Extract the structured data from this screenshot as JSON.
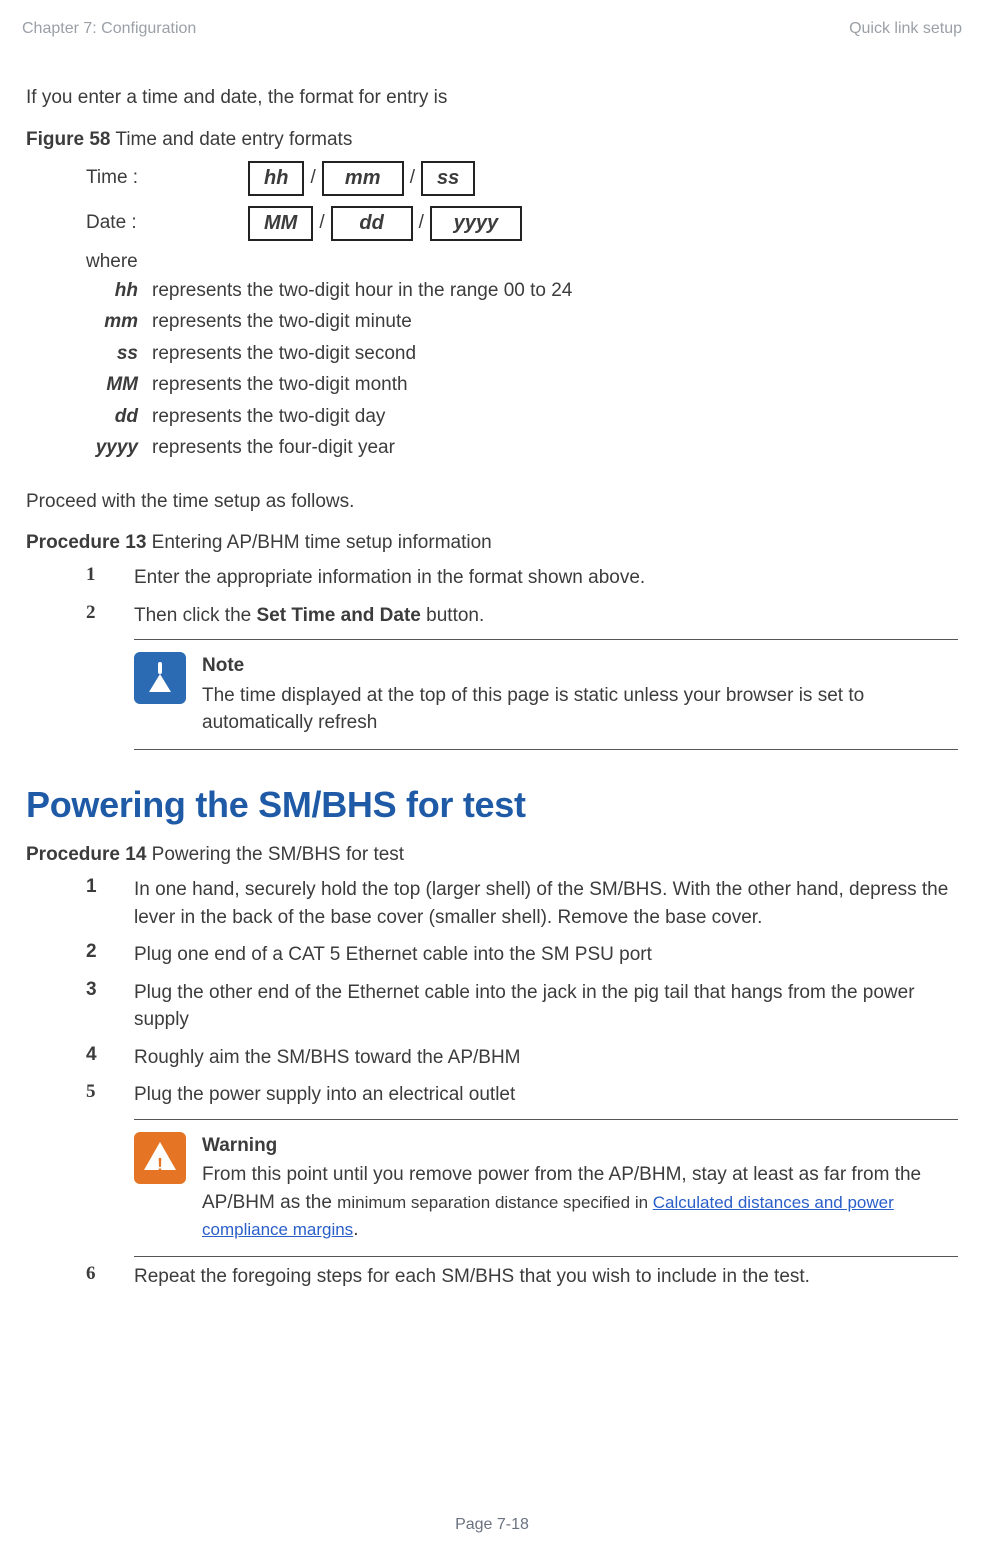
{
  "runhead": {
    "left": "Chapter 7:  Configuration",
    "right": "Quick link setup"
  },
  "intro_para": "If you enter a time and date, the format for entry is",
  "figure": {
    "lead": "Figure 58",
    "caption": "  Time and date entry formats",
    "time_label": "Time :",
    "date_label": "Date :",
    "time_cells": {
      "a": "hh",
      "b": "mm",
      "c": "ss"
    },
    "date_cells": {
      "a": "MM",
      "b": "dd",
      "c": "yyyy"
    },
    "sep": "/",
    "where": "where",
    "defs": {
      "hh_sym": "hh",
      "hh_txt": "represents the two-digit hour in the range 00 to 24",
      "mm_sym": "mm",
      "mm_txt": "represents the two-digit minute",
      "ss_sym": "ss",
      "ss_txt": "represents the two-digit second",
      "MM_sym": "MM",
      "MM_txt": "represents the two-digit month",
      "dd_sym": "dd",
      "dd_txt": "represents the two-digit day",
      "yyyy_sym": "yyyy",
      "yyyy_txt": "represents the four-digit year"
    }
  },
  "proceed_para": "Proceed with the time setup as follows.",
  "proc13": {
    "lead": "Procedure 13",
    "caption": "  Entering AP/BHM time setup information",
    "step1_num": "1",
    "step1_txt": "Enter the appropriate information in the format shown above.",
    "step2_num": "2",
    "step2_pre": "Then click the ",
    "step2_bold": "Set Time and Date",
    "step2_post": " button.",
    "note_title": "Note",
    "note_body": "The time displayed at the top of this page is static unless your browser is set to automatically refresh"
  },
  "h2": "Powering the SM/BHS for test",
  "proc14": {
    "lead": "Procedure 14",
    "caption": "  Powering the SM/BHS for test",
    "step1_num": "1",
    "step1_txt": "In one hand, securely hold the top (larger shell) of the SM/BHS. With the other hand, depress the lever in the back of the base cover (smaller shell). Remove the base cover.",
    "step2_num": "2",
    "step2_txt": "Plug one end of a CAT 5 Ethernet cable into the SM PSU port",
    "step3_num": "3",
    "step3_txt": "Plug the other end of the Ethernet cable into the jack in the pig tail that hangs from the power supply",
    "step4_num": "4",
    "step4_txt": "Roughly aim the SM/BHS toward the AP/BHM",
    "step5_num": "5",
    "step5_txt": "Plug the power supply into an electrical outlet",
    "warn_title": "Warning",
    "warn_pre": "From this point until you remove power from the AP/BHM, stay at least as far from the AP/BHM as the ",
    "warn_small": "minimum separation distance specified in ",
    "warn_link": "Calculated distances and power compliance margins",
    "warn_post": ".",
    "step6_num": "6",
    "step6_txt": "Repeat the foregoing steps for each SM/BHS that you wish to include in the test."
  },
  "footer": "Page 7-18"
}
